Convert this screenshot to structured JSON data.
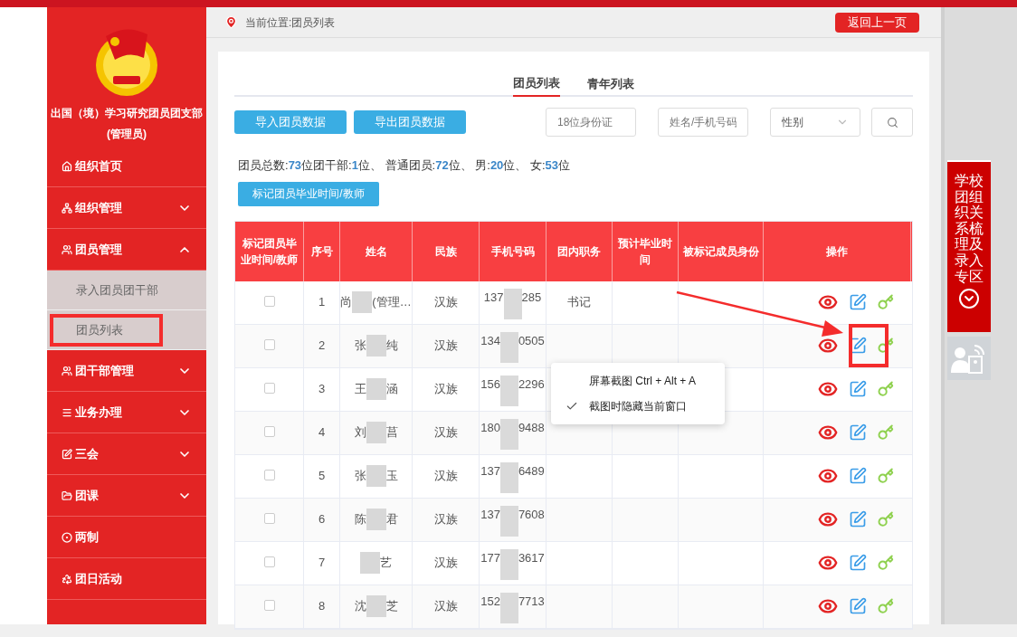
{
  "sidebar": {
    "org_title": "出国（境）学习研究团员团支部",
    "role": "(管理员)",
    "menu": [
      {
        "label": "组织首页"
      },
      {
        "label": "组织管理",
        "expanded": false
      },
      {
        "label": "团员管理",
        "expanded": true,
        "children": [
          {
            "label": "录入团员团干部"
          },
          {
            "label": "团员列表"
          }
        ]
      },
      {
        "label": "团干部管理",
        "expanded": false
      },
      {
        "label": "业务办理",
        "expanded": false
      },
      {
        "label": "三会",
        "expanded": false
      },
      {
        "label": "团课",
        "expanded": false
      },
      {
        "label": "两制"
      },
      {
        "label": "团日活动"
      }
    ]
  },
  "breadcrumb": "当前位置:团员列表",
  "back_button": "返回上一页",
  "tabs": [
    {
      "label": "团员列表",
      "selected": true
    },
    {
      "label": "青年列表",
      "selected": false
    }
  ],
  "toolbar": {
    "buttons": [
      "导入团员数据",
      "导出团员数据"
    ],
    "id_field": {
      "placeholder": "18位身份证"
    },
    "name_field": {
      "placeholder": "姓名/手机号码"
    },
    "gender_select": {
      "value": "性别"
    }
  },
  "stats": "团员总数:**73**位团干部:**1**位、 普通团员:**72**位、 男:**20**位、 女:**53**位",
  "mark_button": "标记团员毕业时间/教师",
  "table": {
    "columns": [
      "标记团员毕业时间/教师",
      "序号",
      "姓名",
      "民族",
      "手机号码",
      "团内职务",
      "预计毕业时间",
      "被标记成员身份",
      "操作"
    ],
    "rows": [
      {
        "checked": false,
        "index": "1",
        "name_start": "尚",
        "name_end": "(管理…",
        "ethnicity": "汉族",
        "phone_start": "137",
        "phone_end": "285",
        "role": "书记"
      },
      {
        "checked": false,
        "index": "2",
        "name_start": "张",
        "name_end": "纯",
        "ethnicity": "汉族",
        "phone_start": "134",
        "phone_end": "0505"
      },
      {
        "checked": false,
        "index": "3",
        "name_start": "王",
        "name_end": "涵",
        "ethnicity": "汉族",
        "phone_start": "156",
        "phone_end": "2296"
      },
      {
        "checked": false,
        "index": "4",
        "name_start": "刘",
        "name_end": "菖",
        "ethnicity": "汉族",
        "phone_start": "180",
        "phone_end": "9488"
      },
      {
        "checked": false,
        "index": "5",
        "name_start": "张",
        "name_end": "玉",
        "ethnicity": "汉族",
        "phone_start": "137",
        "phone_end": "6489"
      },
      {
        "checked": false,
        "index": "6",
        "name_start": "陈",
        "name_end": "君",
        "ethnicity": "汉族",
        "phone_start": "137",
        "phone_end": "7608"
      },
      {
        "checked": false,
        "index": "7",
        "name_end": "艺",
        "ethnicity": "汉族",
        "phone_start": "177",
        "phone_end": "3617"
      },
      {
        "checked": false,
        "index": "8",
        "name_start": "沈",
        "name_end": "芝",
        "ethnicity": "汉族",
        "phone_start": "152",
        "phone_end": "7713"
      }
    ]
  },
  "context_menu": [
    {
      "label": "屏幕截图 Ctrl + Alt + A",
      "checked": false
    },
    {
      "label": "截图时隐藏当前窗口",
      "checked": true
    }
  ],
  "side_panel": {
    "title": "学校团组织关系梳理及录入专区"
  }
}
